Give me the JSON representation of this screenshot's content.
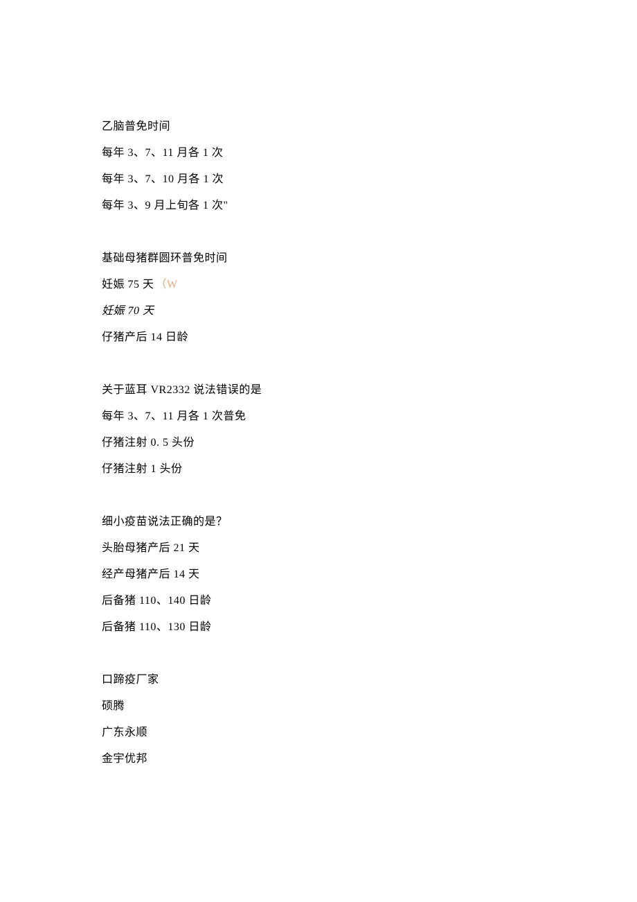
{
  "blocks": [
    {
      "title": "乙脑普免时间",
      "options": [
        {
          "text": "每年 3、7、11 月各 1 次"
        },
        {
          "text": "每年 3、7、10 月各 1 次"
        },
        {
          "text": "每年 3、9 月上旬各 1 次\""
        }
      ]
    },
    {
      "title": "基础母猪群圆环普免时间",
      "options": [
        {
          "text": "妊娠 75 天",
          "annotation": "（W"
        },
        {
          "text": "妊娠 70 天",
          "italic": true
        },
        {
          "text": "仔猪产后 14 日龄"
        }
      ]
    },
    {
      "title": "关于蓝耳 VR2332 说法错误的是",
      "options": [
        {
          "text": "每年 3、7、11 月各 1 次普免"
        },
        {
          "text": "仔猪注射 0. 5 头份"
        },
        {
          "text": "仔猪注射 1 头份"
        }
      ]
    },
    {
      "title": "细小疫苗说法正确的是？",
      "options": [
        {
          "text": "头胎母猪产后 21 天"
        },
        {
          "text": "经产母猪产后 14 天"
        },
        {
          "text": "后备猪 110、140 日龄"
        },
        {
          "text": "后备猪 110、130 日龄"
        }
      ]
    },
    {
      "title": "口蹄疫厂家",
      "options": [
        {
          "text": "硕腾"
        },
        {
          "text": "广东永顺"
        },
        {
          "text": "金宇优邦"
        }
      ]
    }
  ]
}
